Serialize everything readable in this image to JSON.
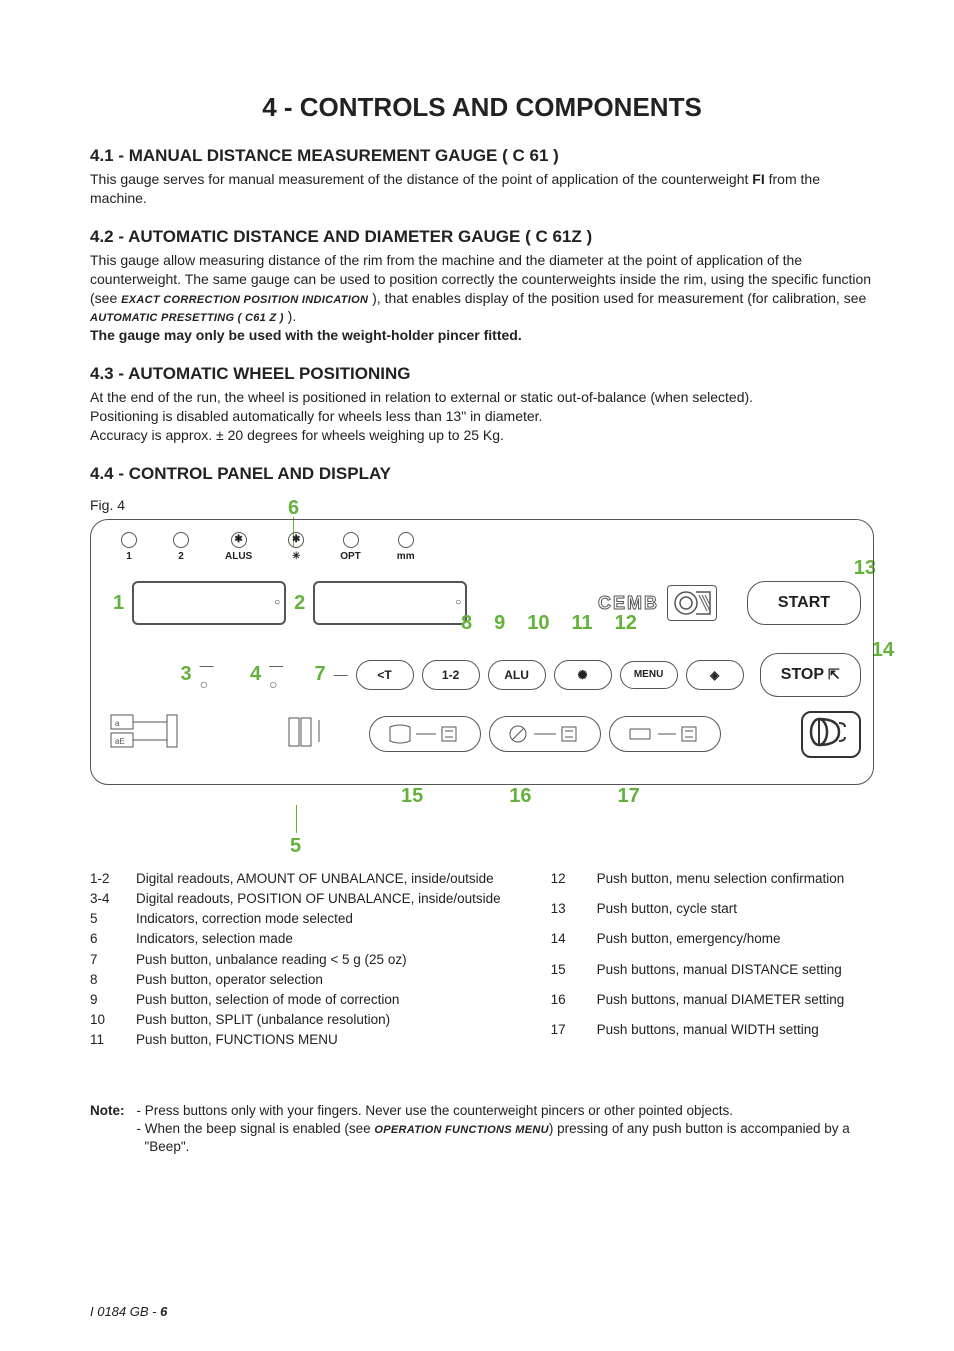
{
  "title": "4 - CONTROLS AND COMPONENTS",
  "s41": {
    "h": "4.1 - MANUAL DISTANCE MEASUREMENT GAUGE ( C 61 )",
    "p1a": "This gauge serves for manual measurement of the distance of the point of application of the counterweight ",
    "p1b": "FI",
    "p1c": " from the machine."
  },
  "s42": {
    "h": "4.2 - AUTOMATIC DISTANCE AND DIAMETER GAUGE ( C 61Z )",
    "p1a": "This gauge allow measuring distance of the rim from the machine and the diameter at the point of application of the counterweight.  The same gauge can be used to position correctly the counterweights inside the rim, using the specific function (see ",
    "p1b": "EXACT CORRECTION POSITION  INDICATION",
    "p1c": " ), that enables display of the position used for measurement (for calibration, see  ",
    "p1d": "AUTOMATIC PRESETTING ( C61 Z )",
    "p1e": " ).",
    "p2": "The gauge may only be used with the weight-holder pincer fitted."
  },
  "s43": {
    "h": "4.3 - AUTOMATIC WHEEL POSITIONING",
    "p1": "At the end of the run, the wheel is positioned in relation to external or static out-of-balance (when selected).",
    "p2": "Positioning is disabled automatically for wheels less than 13\" in diameter.",
    "p3": "Accuracy is approx.  ± 20 degrees for wheels weighing up to 25 Kg."
  },
  "s44": {
    "h": "4.4 - CONTROL PANEL AND DISPLAY"
  },
  "fig": {
    "label": "Fig. 4",
    "leds": [
      "1",
      "2",
      "ALUS",
      "*",
      "OPT",
      "mm"
    ],
    "brand": "CEMB",
    "btn_lt": "<T",
    "btn_12": "1-2",
    "btn_alu": "ALU",
    "btn_menu": "MENU",
    "btn_start": "START",
    "btn_stop": "STOP",
    "callouts": {
      "c1": "1",
      "c2": "2",
      "c3": "3",
      "c4": "4",
      "c5": "5",
      "c6": "6",
      "c7": "7",
      "c8": "8",
      "c9": "9",
      "c10": "10",
      "c11": "11",
      "c12": "12",
      "c13": "13",
      "c14": "14",
      "c15": "15",
      "c16": "16",
      "c17": "17"
    }
  },
  "legendL": [
    {
      "k": "1-2",
      "v": "Digital readouts, AMOUNT OF UNBALANCE, inside/outside"
    },
    {
      "k": "3-4",
      "v": "Digital readouts, POSITION  OF UNBALANCE, inside/outside"
    },
    {
      "k": "5",
      "v": "Indicators, correction mode selected"
    },
    {
      "k": "6",
      "v": "Indicators, selection made"
    },
    {
      "k": "7",
      "v": "Push button, unbalance reading < 5 g (25 oz)"
    },
    {
      "k": "8",
      "v": "Push button, operator selection"
    },
    {
      "k": "9",
      "v": "Push button, selection of mode of correction"
    },
    {
      "k": "10",
      "v": "Push button, SPLIT  (unbalance resolution)"
    },
    {
      "k": "11",
      "v": "Push button, FUNCTIONS MENU"
    }
  ],
  "legendR": [
    {
      "k": "12",
      "v": "Push button, menu selection confirmation"
    },
    {
      "k": "13",
      "v": "Push button, cycle start"
    },
    {
      "k": "14",
      "v": "Push button, emergency/home"
    },
    {
      "k": "15",
      "v": "Push buttons, manual DISTANCE setting"
    },
    {
      "k": "16",
      "v": "Push buttons, manual DIAMETER setting"
    },
    {
      "k": "17",
      "v": "Push buttons, manual WIDTH setting"
    }
  ],
  "note": {
    "label": "Note:",
    "l1": "- Press buttons only with your fingers. Never use the counterweight pincers or other pointed objects.",
    "l2a": "- When the beep signal is enabled (see ",
    "l2b": "OPERATION FUNCTIONS MENU",
    "l2c": ") pressing of any push button is accompanied by a  \"Beep\"."
  },
  "footer": {
    "a": "I 0184  GB - ",
    "b": "6"
  }
}
